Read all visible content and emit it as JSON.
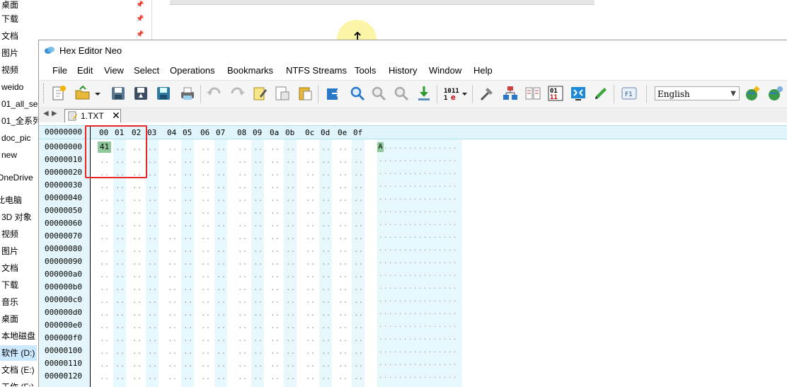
{
  "sidebar": {
    "items": [
      {
        "label": "桌面"
      },
      {
        "label": "下载"
      },
      {
        "label": "文档"
      },
      {
        "label": "图片"
      },
      {
        "label": "视频"
      },
      {
        "label": "weido"
      },
      {
        "label": "01_all_se"
      },
      {
        "label": "01_全系列"
      },
      {
        "label": "doc_pic"
      },
      {
        "label": "new"
      },
      {
        "label": "OneDrive"
      },
      {
        "label": "此电脑"
      },
      {
        "label": "3D 对象"
      },
      {
        "label": "视频"
      },
      {
        "label": "图片"
      },
      {
        "label": "文档"
      },
      {
        "label": "下载"
      },
      {
        "label": "音乐"
      },
      {
        "label": "桌面"
      },
      {
        "label": "本地磁盘"
      },
      {
        "label": "软件 (D:)"
      },
      {
        "label": "文档 (E:)"
      },
      {
        "label": "工作 (F:)"
      }
    ]
  },
  "window": {
    "title": "Hex Editor Neo",
    "menu": [
      "File",
      "Edit",
      "View",
      "Select",
      "Operations",
      "Bookmarks",
      "NTFS Streams",
      "Tools",
      "History",
      "Window",
      "Help"
    ],
    "language": "English",
    "tab": {
      "label": "1.TXT",
      "close": "✕"
    },
    "tab_nav": {
      "prev": "◀",
      "next": "▶"
    }
  },
  "hex": {
    "offset_header": "00000000",
    "columns": [
      "00",
      "01",
      "02",
      "03",
      "04",
      "05",
      "06",
      "07",
      "08",
      "09",
      "0a",
      "0b",
      "0c",
      "0d",
      "0e",
      "0f"
    ],
    "rows": [
      "00000000",
      "00000010",
      "00000020",
      "00000030",
      "00000040",
      "00000050",
      "00000060",
      "00000070",
      "00000080",
      "00000090",
      "000000a0",
      "000000b0",
      "000000c0",
      "000000d0",
      "000000e0",
      "000000f0",
      "00000100",
      "00000110",
      "00000120"
    ],
    "selected_byte": "41",
    "selected_char": "A",
    "empty_cell": "..",
    "empty_char": "."
  },
  "colors": {
    "selection": "#8fc99b",
    "highlight_box": "#e8262a",
    "stripe": "#e7f8fc"
  }
}
